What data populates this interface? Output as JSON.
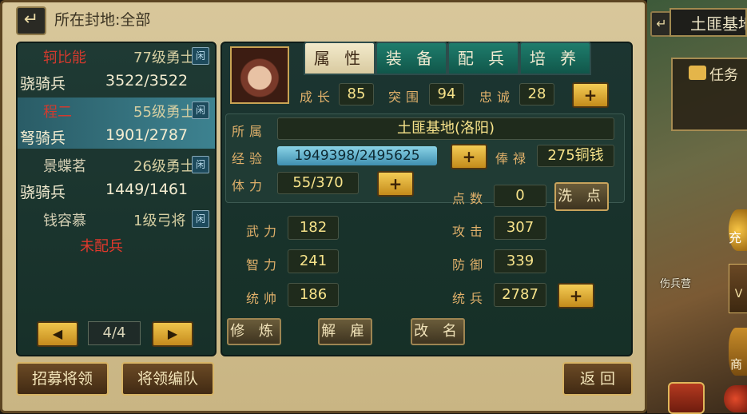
{
  "header": {
    "location_text": "所在封地:全部",
    "back_icon": "return-arrow-icon"
  },
  "generals": [
    {
      "name": "轲比能",
      "level": "77级勇士",
      "troop": "骁骑兵",
      "count": "3522/3522",
      "tag": "闲"
    },
    {
      "name": "程二",
      "level": "55级勇士",
      "troop": "弩骑兵",
      "count": "1901/2787",
      "tag": "闲"
    },
    {
      "name": "景蝶茗",
      "level": "26级勇士",
      "troop": "骁骑兵",
      "count": "1449/1461",
      "tag": "闲"
    },
    {
      "name": "钱容慕",
      "level": "1级弓将",
      "troop": "",
      "count": "",
      "tag": "闲",
      "none_text": "未配兵"
    }
  ],
  "pager": {
    "page": "4/4"
  },
  "bottom_buttons": {
    "recruit": "招募将领",
    "formation": "将领编队",
    "back": "返 回"
  },
  "tabs": [
    "属 性",
    "装 备",
    "配 兵",
    "培 养"
  ],
  "stats": {
    "growth_label": "成长",
    "growth": "85",
    "breakthrough_label": "突围",
    "breakthrough": "94",
    "loyalty_label": "忠诚",
    "loyalty": "28",
    "belong_label": "所属",
    "belong": "土匪基地(洛阳)",
    "exp_label": "经验",
    "exp": "1949398/2495625",
    "salary_label": "俸禄",
    "salary": "275铜钱",
    "stamina_label": "体力",
    "stamina": "55/370",
    "points_label": "点数",
    "points": "0",
    "wash_label": "洗 点",
    "force_label": "武力",
    "force": "182",
    "intel_label": "智力",
    "intel": "241",
    "command_label": "统帅",
    "command": "186",
    "attack_label": "攻击",
    "attack": "307",
    "defense_label": "防御",
    "defense": "339",
    "troops_label": "统兵",
    "troops": "2787"
  },
  "actions": {
    "train": "修 炼",
    "dismiss": "解 雇",
    "rename": "改 名"
  },
  "right_panel": {
    "title": "土匪基地",
    "task": "任务",
    "charge": "充",
    "wounded_camp": "伤兵营",
    "vip": "V",
    "shop": "商"
  }
}
